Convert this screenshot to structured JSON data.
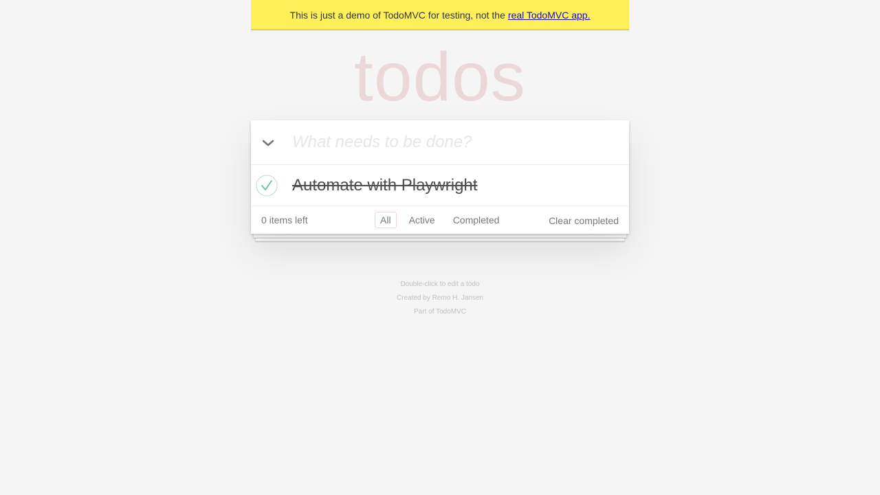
{
  "banner": {
    "text": "This is just a demo of TodoMVC for testing, not the",
    "link_label": "real TodoMVC app."
  },
  "header": {
    "title": "todos",
    "input_placeholder": "What needs to be done?",
    "input_value": ""
  },
  "todos": [
    {
      "label": "Automate with Playwright",
      "completed": true
    }
  ],
  "footer": {
    "count_text": "0 items left",
    "filters": [
      {
        "label": "All",
        "selected": true
      },
      {
        "label": "Active",
        "selected": false
      },
      {
        "label": "Completed",
        "selected": false
      }
    ],
    "clear_label": "Clear completed"
  },
  "info": {
    "line1": "Double-click to edit a todo",
    "line2": "Created by Remo H. Jansen",
    "line3": "Part of TodoMVC"
  },
  "colors": {
    "banner_bg": "#fff05a",
    "title": "rgba(175,47,47,0.15)",
    "check": "#5dc2af"
  },
  "icons": {
    "toggle_all": "chevron-down-icon",
    "completed_check": "check-circle-icon"
  }
}
